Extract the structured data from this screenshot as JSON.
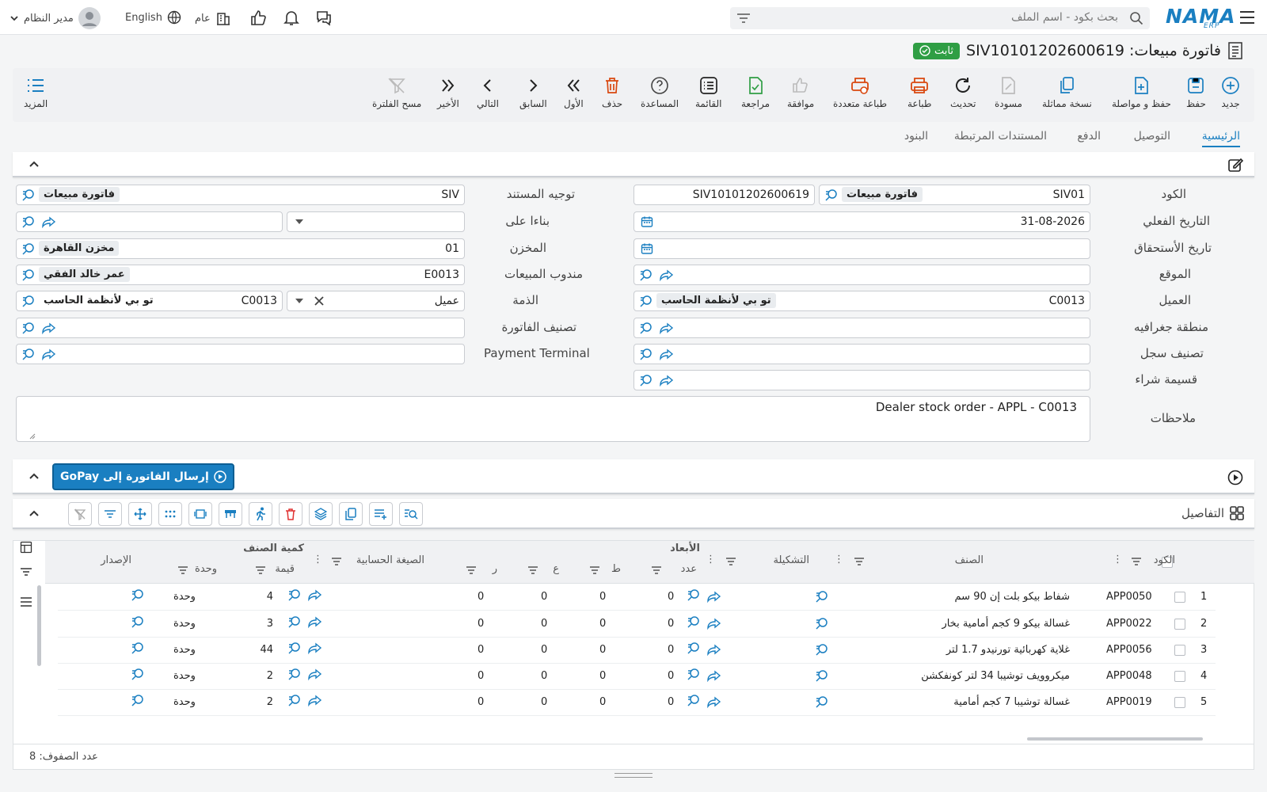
{
  "topbar": {
    "search_placeholder": "بحث بكود - اسم الملف",
    "logo": "NAMA",
    "logo_sub": "ERP",
    "user_label": "مدير النظام",
    "language": "English",
    "branch": "عام"
  },
  "title": {
    "text": "فاتورة مبيعات: SIV10101202600619",
    "status": "ثابت"
  },
  "toolbar": {
    "new": "جديد",
    "save": "حفظ",
    "save_continue": "حفظ و مواصلة",
    "duplicate": "نسخة مماثلة",
    "draft": "مسودة",
    "refresh": "تحديث",
    "print": "طباعة",
    "multi_print": "طباعة متعددة",
    "approve": "موافقة",
    "review": "مراجعة",
    "list": "القائمة",
    "help": "المساعدة",
    "delete": "حذف",
    "first": "الأول",
    "previous": "السابق",
    "next": "التالي",
    "last": "الأخير",
    "clear_filter": "مسح الفلترة",
    "more": "المزيد"
  },
  "tabs": [
    "الرئيسية",
    "التوصيل",
    "الدفع",
    "المستندات المرتبطة",
    "البنود"
  ],
  "form": {
    "code_label": "الكود",
    "code_value": "SIV01",
    "code_chip": "فاتورة مبيعات",
    "code_number": "SIV10101202600619",
    "actual_date_label": "التاريخ الفعلي",
    "actual_date": "31-08-2026",
    "due_date_label": "تاريخ الأستحقاق",
    "site_label": "الموقع",
    "customer_label": "العميل",
    "customer_code": "C0013",
    "customer_name": "تو بي لأنظمة الحاسب",
    "geo_label": "منطقة جغرافيه",
    "record_class_label": "تصنيف سجل",
    "purchase_coupon_label": "قسيمة شراء",
    "notes_label": "ملاحظات",
    "notes_value": "Dealer stock order - APPL - C0013",
    "doc_direction_label": "توجيه المستند",
    "doc_direction_value": "SIV",
    "doc_direction_chip": "فاتورة مبيعات",
    "based_on_label": "بناءا على",
    "warehouse_label": "المخزن",
    "warehouse_code": "01",
    "warehouse_name": "مخزن القاهرة",
    "salesman_label": "مندوب المبيعات",
    "salesman_code": "E0013",
    "salesman_name": "عمر خالد الفقي",
    "liability_label": "الذمة",
    "liability_type": "عميل",
    "liability_code": "C0013",
    "liability_name": "تو بي لأنظمة الحاسب",
    "invoice_class_label": "تصنيف الفاتورة",
    "payment_terminal_label": "Payment Terminal"
  },
  "gopay_button": "إرسال الفاتورة إلى GoPay",
  "details": {
    "title": "التفاصيل",
    "headers": {
      "code": "الكود",
      "item": "الصنف",
      "config": "التشكيلة",
      "dimensions": "الأبعاد",
      "count": "عدد",
      "l": "ط",
      "w": "ع",
      "h": "ر",
      "formula": "الصيغة الحسابية",
      "qty": "كمية الصنف",
      "unit": "وحدة",
      "value": "قيمة",
      "version": "الإصدار"
    },
    "rows": [
      {
        "n": "1",
        "code": "APP0050",
        "item": "شفاط بيكو بلت إن 90 سم",
        "count": "0",
        "l": "0",
        "w": "0",
        "h": "0",
        "value": "4",
        "unit": "وحدة"
      },
      {
        "n": "2",
        "code": "APP0022",
        "item": "غسالة بيكو 9 كجم أمامية بخار",
        "count": "0",
        "l": "0",
        "w": "0",
        "h": "0",
        "value": "3",
        "unit": "وحدة"
      },
      {
        "n": "3",
        "code": "APP0056",
        "item": "غلاية كهربائية تورنيدو 1.7 لتر",
        "count": "0",
        "l": "0",
        "w": "0",
        "h": "0",
        "value": "44",
        "unit": "وحدة"
      },
      {
        "n": "4",
        "code": "APP0048",
        "item": "ميكروويف توشيبا 34 لتر كونفكشن",
        "count": "0",
        "l": "0",
        "w": "0",
        "h": "0",
        "value": "2",
        "unit": "وحدة"
      },
      {
        "n": "5",
        "code": "APP0019",
        "item": "غسالة توشيبا 7 كجم أمامية",
        "count": "0",
        "l": "0",
        "w": "0",
        "h": "0",
        "value": "2",
        "unit": "وحدة"
      }
    ],
    "row_count": "عدد الصفوف: 8"
  },
  "colors": {
    "accent": "#1a7fc1",
    "status": "#2f9e44",
    "danger": "#d9480f"
  }
}
